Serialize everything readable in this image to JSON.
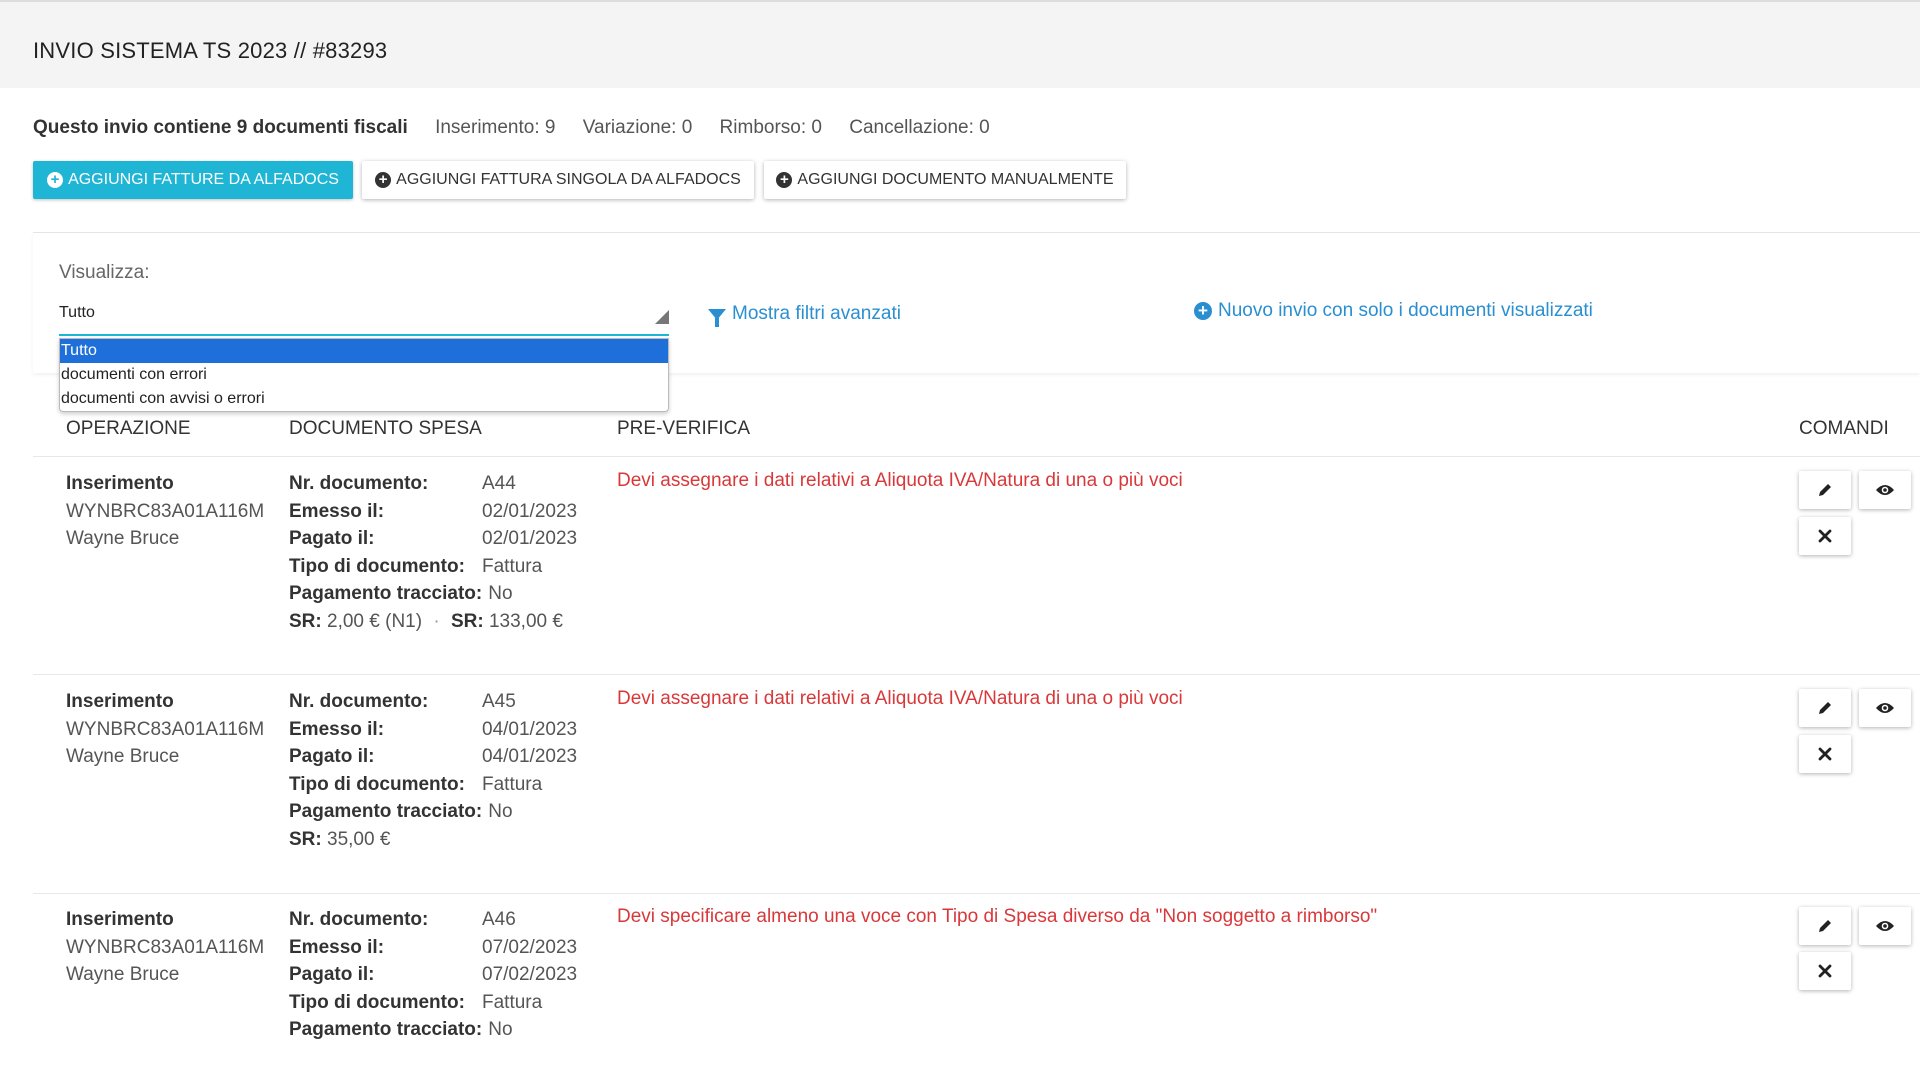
{
  "header": {
    "title": "INVIO SISTEMA TS 2023 // #83293"
  },
  "summary": {
    "main": "Questo invio contiene 9 documenti fiscali",
    "inserimento": "Inserimento: 9",
    "variazione": "Variazione: 0",
    "rimborso": "Rimborso: 0",
    "cancellazione": "Cancellazione: 0"
  },
  "toolbar": {
    "add_invoices_label": "AGGIUNGI FATTURE DA ALFADOCS",
    "add_single_invoice_label": "AGGIUNGI FATTURA SINGOLA DA ALFADOCS",
    "add_manual_label": "AGGIUNGI DOCUMENTO MANUALMENTE"
  },
  "filters": {
    "label": "Visualizza:",
    "selected": "Tutto",
    "options": [
      "Tutto",
      "documenti con errori",
      "documenti con avvisi o errori"
    ],
    "advanced_filters_link": "Mostra filtri avanzati",
    "new_submission_link": "Nuovo invio con solo i documenti visualizzati"
  },
  "table": {
    "headers": {
      "operazione": "OPERAZIONE",
      "documento": "DOCUMENTO SPESA",
      "preverifica": "PRE-VERIFICA",
      "comandi": "COMANDI"
    },
    "field_labels": {
      "nr": "Nr. documento:",
      "emesso": "Emesso il:",
      "pagato": "Pagato il:",
      "tipo": "Tipo di documento:",
      "tracciato": "Pagamento tracciato:",
      "sr": "SR:"
    },
    "rows": [
      {
        "op_type": "Inserimento",
        "code": "WYNBRC83A01A116M",
        "name": "Wayne Bruce",
        "nr": "A44",
        "emesso": "02/01/2023",
        "pagato": "02/01/2023",
        "tipo": "Fattura",
        "tracciato": "No",
        "sr1": "2,00 € (N1)",
        "sr_sep": "·",
        "sr2": "133,00 €",
        "error": "Devi assegnare i dati relativi a Aliquota IVA/Natura di una o più voci"
      },
      {
        "op_type": "Inserimento",
        "code": "WYNBRC83A01A116M",
        "name": "Wayne Bruce",
        "nr": "A45",
        "emesso": "04/01/2023",
        "pagato": "04/01/2023",
        "tipo": "Fattura",
        "tracciato": "No",
        "sr1": "35,00 €",
        "error": "Devi assegnare i dati relativi a Aliquota IVA/Natura di una o più voci"
      },
      {
        "op_type": "Inserimento",
        "code": "WYNBRC83A01A116M",
        "name": "Wayne Bruce",
        "nr": "A46",
        "emesso": "07/02/2023",
        "pagato": "07/02/2023",
        "tipo": "Fattura",
        "tracciato": "No",
        "error": "Devi specificare almeno una voce con Tipo di Spesa diverso da \"Non soggetto a rimborso\""
      }
    ]
  },
  "icons": {
    "edit": "pencil-icon",
    "view": "eye-icon",
    "delete": "close-icon",
    "filter": "funnel-icon",
    "add": "plus-circle-icon"
  },
  "colors": {
    "accent": "#1fb5d4",
    "link": "#2a8fd0",
    "error": "#d9383a",
    "dropdown_selected": "#1e6fd9"
  }
}
